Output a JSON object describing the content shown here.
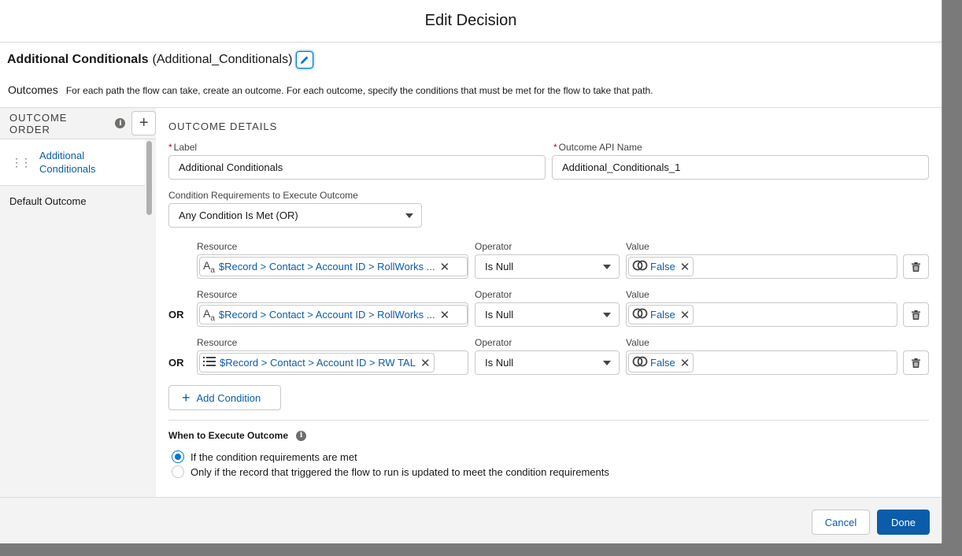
{
  "modal": {
    "title": "Edit Decision"
  },
  "decision": {
    "label": "Additional Conditionals",
    "api_name": "(Additional_Conditionals)"
  },
  "outcomes": {
    "label": "Outcomes",
    "description": "For each path the flow can take, create an outcome. For each outcome, specify the conditions that must be met for the flow to take that path."
  },
  "sidebar": {
    "heading": "OUTCOME ORDER",
    "items": [
      {
        "label": "Additional Conditionals",
        "active": true
      },
      {
        "label": "Default Outcome",
        "active": false
      }
    ]
  },
  "details": {
    "heading": "OUTCOME DETAILS",
    "label_field": {
      "label": "Label",
      "value": "Additional Conditionals"
    },
    "api_field": {
      "label": "Outcome API Name",
      "value": "Additional_Conditionals_1"
    },
    "requirements": {
      "label": "Condition Requirements to Execute Outcome",
      "value": "Any Condition Is Met (OR)"
    },
    "conditions": [
      {
        "prefix": "",
        "resource_label": "Resource",
        "resource": "$Record > Contact > Account ID > RollWorks ...",
        "resource_icon": "text-type-icon",
        "operator_label": "Operator",
        "operator": "Is Null",
        "value_label": "Value",
        "value": "False"
      },
      {
        "prefix": "OR",
        "resource_label": "Resource",
        "resource": "$Record > Contact > Account ID > RollWorks ...",
        "resource_icon": "text-type-icon",
        "operator_label": "Operator",
        "operator": "Is Null",
        "value_label": "Value",
        "value": "False"
      },
      {
        "prefix": "OR",
        "resource_label": "Resource",
        "resource": "$Record > Contact > Account ID > RW TAL",
        "resource_icon": "picklist-icon",
        "operator_label": "Operator",
        "operator": "Is Null",
        "value_label": "Value",
        "value": "False"
      }
    ],
    "add_condition": "Add Condition",
    "when": {
      "label": "When to Execute Outcome",
      "options": [
        {
          "label": "If the condition requirements are met",
          "selected": true
        },
        {
          "label": "Only if the record that triggered the flow to run is updated to meet the condition requirements",
          "selected": false
        }
      ]
    }
  },
  "footer": {
    "cancel": "Cancel",
    "done": "Done"
  },
  "colors": {
    "link": "#0b5cab",
    "brand": "#0176d3",
    "required": "#ba0517"
  }
}
